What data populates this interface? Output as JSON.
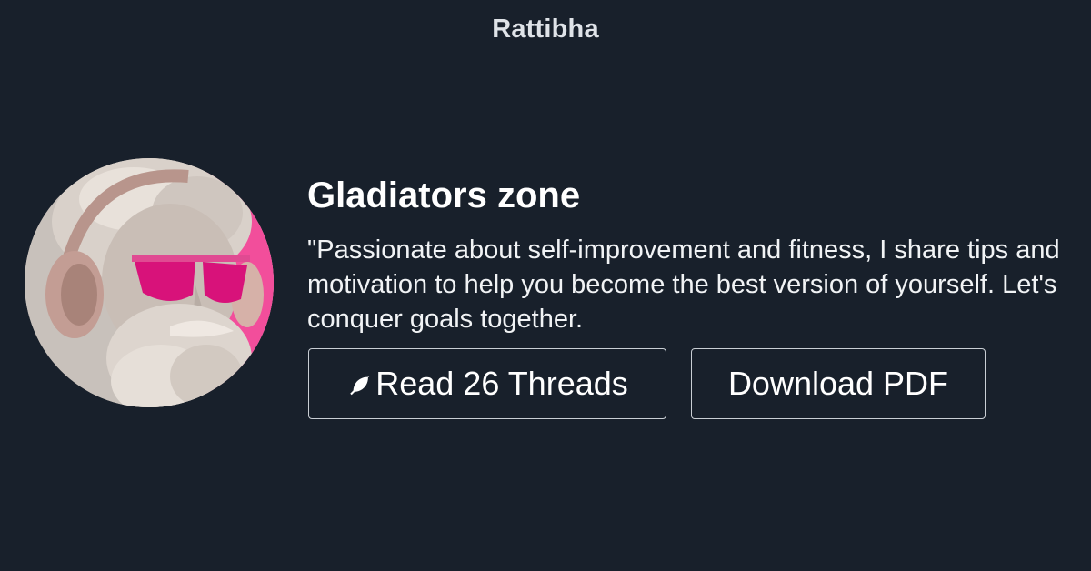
{
  "header": {
    "brand": "Rattibha"
  },
  "profile": {
    "name": "Gladiators zone",
    "bio": "\"Passionate about self-improvement and fitness, I share tips and motivation to help you become the best version of yourself. Let's conquer goals together.",
    "avatar_description_icon": "avatar-statue-headphones-image"
  },
  "actions": {
    "read_label": "Read 26 Threads",
    "read_icon": "feather-icon",
    "download_label": "Download PDF"
  },
  "colors": {
    "background": "#18202b",
    "text": "#ffffff",
    "brand_text": "#dfe3e8",
    "button_border": "#c9ced4",
    "accent_pink": "#e0147a"
  }
}
